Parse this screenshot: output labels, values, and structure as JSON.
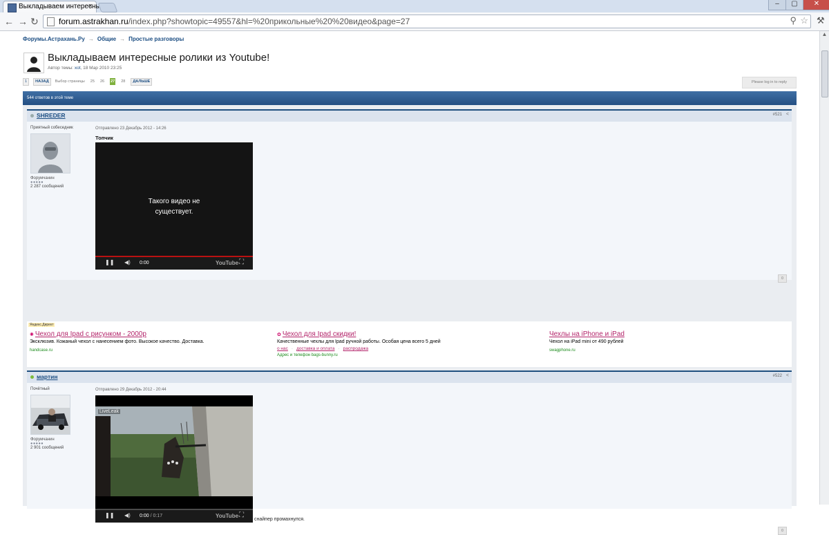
{
  "browser": {
    "tab_title": "Выкладываем интересные",
    "tab_close": "×",
    "url_host": "forum.astrakhan.ru",
    "url_path": "/index.php?showtopic=49557&hl=%20прикольные%20%20видео&page=27",
    "window_controls": [
      "–",
      "▢",
      "✕"
    ]
  },
  "breadcrumb": [
    "Форумы.Астрахань.Ру",
    "Общие",
    "Простые разговоры"
  ],
  "breadcrumb_sep": "→",
  "topic": {
    "title": "Выкладываем интересные ролики из Youtube!",
    "meta_prefix": "Автор темы: ",
    "meta_author": "xot",
    "meta_suffix": ", 18 Мар 2010 23:25"
  },
  "pagination": {
    "first": "1",
    "prev": "НАЗАД",
    "select": "Выбор страницы",
    "pages": [
      "25",
      "26"
    ],
    "current": "27",
    "next_page": "28",
    "next": "ДАЛЬШЕ"
  },
  "reply_button": "Please log in to reply",
  "replies_bar": "544 ответов в этой теме",
  "posts": [
    {
      "author": "SHREDER",
      "number": "#521",
      "user_title": "Приятный собеседник",
      "group": "Форумчанин",
      "pips": "●●●●●",
      "post_count": "2 287 сообщений",
      "date": "Отправлено 23 Декабрь 2012 - 14:26",
      "lead": "Топчик",
      "video": {
        "message_line1": "Такого видео не",
        "message_line2": "существует.",
        "time": "0:00",
        "total": "",
        "brand": "YouTube"
      },
      "foot": "0"
    },
    {
      "author": "мартин",
      "number": "#522",
      "user_title": "Почётный",
      "group": "Форумчанин",
      "pips": "●●●●●",
      "post_count": "2 901 сообщений",
      "date": "Отправлено 29 Декабрь 2012 - 20:44",
      "video": {
        "watermark": "LiveLeak",
        "time": "0:00",
        "total": " / 0:17",
        "brand": "YouTube"
      },
      "trailing_text": "снайпер промахнулся.",
      "foot": "0"
    }
  ],
  "ads": {
    "tag": "Яндекс.Директ",
    "items": [
      {
        "title": "Чехол для Ipad с рисунком - 2000р",
        "desc": "Эксклюзив. Кожаный чехол с нанесением фото. Высокое качество. Доставка.",
        "domain": "handcase.ru"
      },
      {
        "title": "Чехол для Ipad скидки!",
        "desc": "Качественные чехлы для Ipad ручной работы. Особая цена всего 5 дней",
        "links": [
          "о нас",
          "доставка и оплата",
          "распродажа"
        ],
        "domain": "Адрес и телефон  bags-bunny.ru"
      },
      {
        "title": "Чехлы на iPhone и iPad",
        "desc": "Чехол на iPad mini от 490 рублей",
        "domain": "swagphone.ru"
      }
    ]
  },
  "colors": {
    "header_bar": "#244f83",
    "ad_link": "#b3246a",
    "current_page": "#7fb13d"
  }
}
